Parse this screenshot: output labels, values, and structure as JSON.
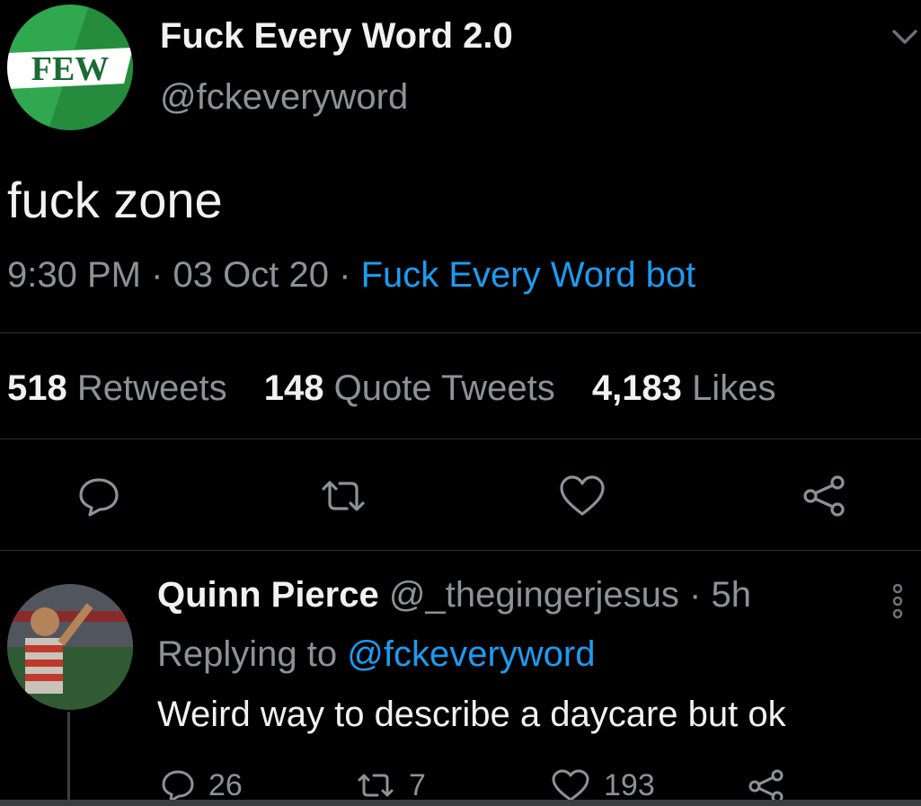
{
  "tweet": {
    "avatar_text": "FEW",
    "display_name": "Fuck Every Word 2.0",
    "handle": "@fckeveryword",
    "text": "fuck zone",
    "time": "9:30 PM",
    "date": "03 Oct 20",
    "source": "Fuck Every Word bot",
    "separator": "·",
    "stats": {
      "retweets_count": "518",
      "retweets_label": "Retweets",
      "quotes_count": "148",
      "quotes_label": "Quote Tweets",
      "likes_count": "4,183",
      "likes_label": "Likes"
    },
    "actions": [
      "reply-icon",
      "retweet-icon",
      "like-icon",
      "share-icon"
    ]
  },
  "reply": {
    "display_name": "Quinn Pierce",
    "handle": "@_thegingerjesus",
    "time_ago": "5h",
    "separator": "·",
    "replying_label": "Replying to",
    "replying_handle": "@fckeveryword",
    "text": "Weird way to describe a daycare but ok",
    "counts": {
      "replies": "26",
      "retweets": "7",
      "likes": "193"
    }
  },
  "colors": {
    "background": "#000000",
    "text": "#e7e9ea",
    "muted": "#8b9299",
    "link": "#1d9bf0",
    "avatar_green": "#2fa84f"
  }
}
